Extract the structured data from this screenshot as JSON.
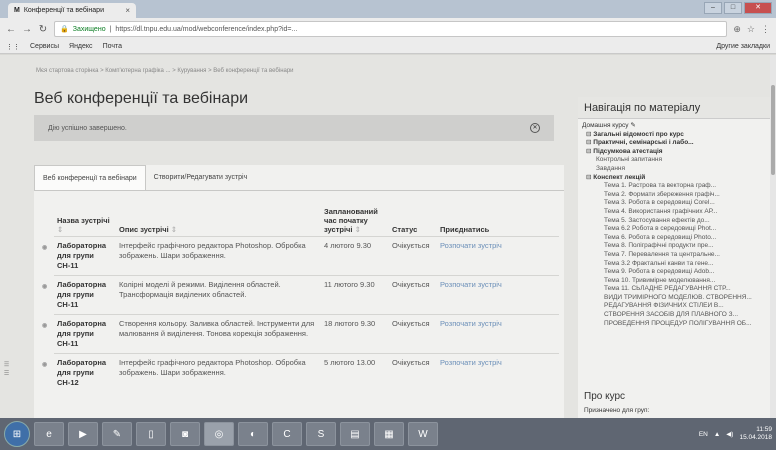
{
  "browser": {
    "tab_title": "Конференції та вебінари",
    "tab_icon": "М",
    "omnibox_secure": "Захищено",
    "url": "https://dl.tnpu.edu.ua/mod/webconference/index.php?id=...",
    "bookmarks": [
      "Сервисы",
      "Яндекс",
      "Почта"
    ],
    "other_bookmarks": "Другие закладки"
  },
  "page": {
    "breadcrumb": "Мєя стартова сторінка  >  Комп'ютерна графіка ...  >  Курування  >  Веб конференції та вебінари",
    "title": "Веб конференції та вебінари",
    "alert_text": "Дію успішно завершено.",
    "tabs": [
      "Веб конференції та вебінари",
      "Створити/Редагувати зустріч"
    ]
  },
  "table": {
    "headers": {
      "name": "Назва зустрічі",
      "desc": "Опис зустрічі",
      "time": "Запланований час початку зустрічі",
      "status": "Статус",
      "action": "Приєднатись"
    },
    "rows": [
      {
        "name": "Лабораторна для групи СН-11",
        "desc": "Інтерфейс графічного редактора Photoshop. Обробка зображень. Шари зображення.",
        "time": "4 лютого 9.30",
        "status": "Очікується",
        "action": "Розпочати зустріч"
      },
      {
        "name": "Лабораторна для групи СН-11",
        "desc": "Колірні моделі й режими. Виділення областей. Трансформація виділених областей.",
        "time": "11 лютого 9.30",
        "status": "Очікується",
        "action": "Розпочати зустріч"
      },
      {
        "name": "Лабораторна для групи СН-11",
        "desc": "Створення кольору. Заливка областей. Інструменти для малювання й виділення. Тонова корекція зображення.",
        "time": "18 лютого 9.30",
        "status": "Очікується",
        "action": "Розпочати зустріч"
      },
      {
        "name": "Лабораторна для групи СН-12",
        "desc": "Інтерфейс графічного редактора Photoshop. Обробка зображень. Шари зображення.",
        "time": "5 лютого 13.00",
        "status": "Очікується",
        "action": "Розпочати зустріч"
      }
    ]
  },
  "nav": {
    "title": "Навігація по матеріалу",
    "home": "Домашня курсу",
    "sections": [
      {
        "text": "Загальні відомості про курс",
        "level": 1
      },
      {
        "text": "Практичні, семінарські і лабо...",
        "level": 1
      },
      {
        "text": "Підсумкова атестація",
        "level": 1
      },
      {
        "text": "Контрольні запитання",
        "level": 2
      },
      {
        "text": "Завдання",
        "level": 2
      },
      {
        "text": "Конспект лекцій",
        "level": 1
      },
      {
        "text": "Тема 1. Растрова та векторна граф...",
        "level": 3
      },
      {
        "text": "Тема 2. Формати збереження графіч...",
        "level": 3
      },
      {
        "text": "Тема 3. Робота в середовищі Corel...",
        "level": 3
      },
      {
        "text": "Тема 4. Використання графічних АР...",
        "level": 3
      },
      {
        "text": "Тема 5. Застосування ефектів до...",
        "level": 3
      },
      {
        "text": "Тема 6.2 Робота в середовищі Phot...",
        "level": 3
      },
      {
        "text": "Тема 6. Робота в середовищі Photo...",
        "level": 3
      },
      {
        "text": "Тема 8. Поліграфічні продукти пре...",
        "level": 3
      },
      {
        "text": "Тема 7. Перевалення та центральне...",
        "level": 3
      },
      {
        "text": "Тема 3.2 Фрактальні канви та гене...",
        "level": 3
      },
      {
        "text": "Тема 9. Робота в середовищі Adob...",
        "level": 3
      },
      {
        "text": "Тема 10. Тривимірне моделювання...",
        "level": 3
      },
      {
        "text": "Тема 11. СЬЛАДНЕ РЕДАГУВАННЯ СТР...",
        "level": 3
      },
      {
        "text": "ВИДИ ТРИМІРНОГО МОДЕЛЮВ. СТВОРЕННЯ...",
        "level": 3
      },
      {
        "text": "РЕДАГУВАННЯ ФІЗИЧНИХ СТІЛЕЙ В...",
        "level": 3
      },
      {
        "text": "СТВОРЕННЯ ЗАСОБІВ ДЛЯ ПЛАВНОГО З...",
        "level": 3
      },
      {
        "text": "ПРОВЕДЕННЯ ПРОЦЕДУР ПОЛІГУВАННЯ ОБ...",
        "level": 3
      }
    ]
  },
  "about": {
    "title": "Про курс",
    "subtitle": "Призначено для груп:"
  },
  "taskbar": {
    "lang": "EN",
    "time": "11:59",
    "date": "15.04.2018"
  }
}
